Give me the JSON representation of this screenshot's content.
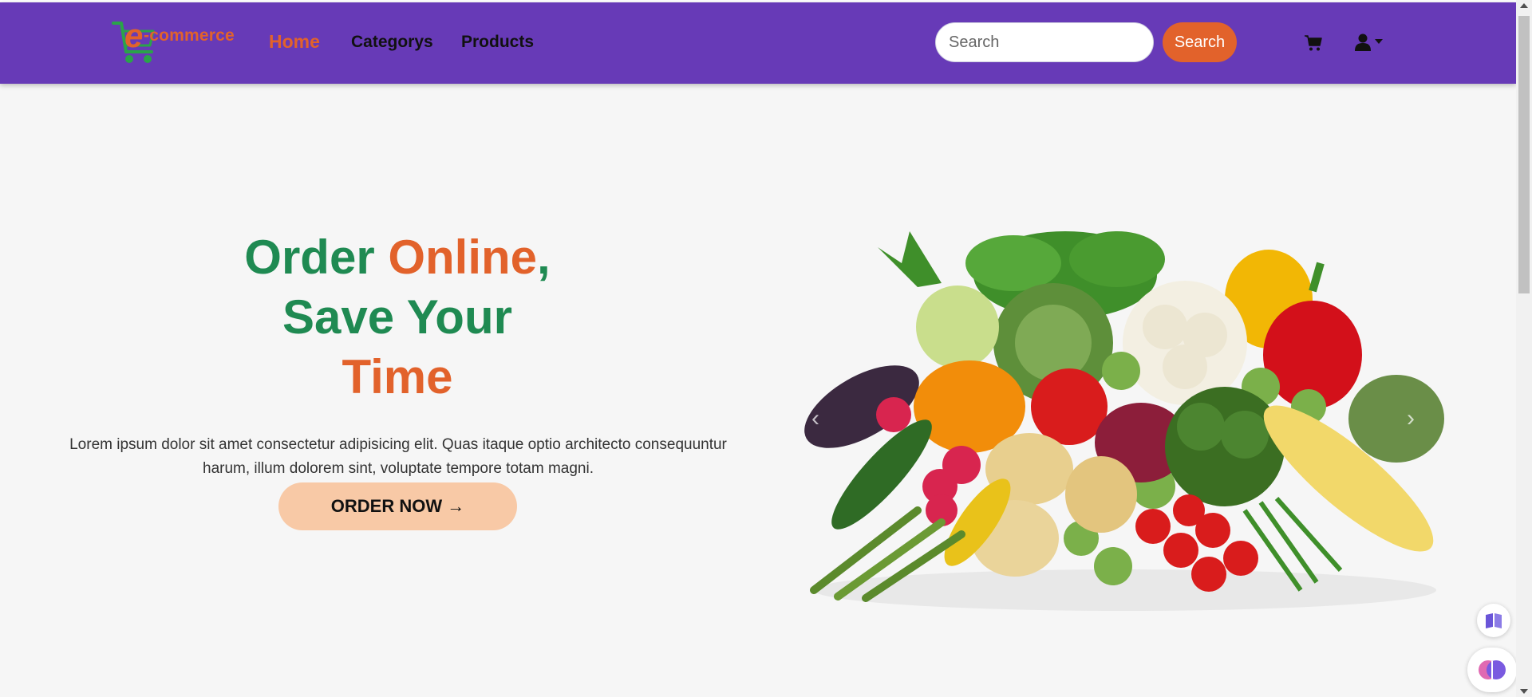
{
  "brand": {
    "logo_text": "-commerce",
    "logo_letter": "e"
  },
  "nav": {
    "home": "Home",
    "categorys": "Categorys",
    "products": "Products"
  },
  "search": {
    "placeholder": "Search",
    "button_label": "Search"
  },
  "icons": {
    "cart": "cart-icon",
    "user": "user-icon",
    "caret": "caret-down-icon",
    "reader": "book-icon",
    "assistant": "brain-icon"
  },
  "hero": {
    "line1_a": "Order ",
    "line1_b": "Online",
    "line1_c": ",",
    "line2": "Save Your",
    "line3": "Time",
    "description": "Lorem ipsum dolor sit amet consectetur adipisicing elit. Quas itaque optio architecto consequuntur harum, illum dolorem sint, voluptate tempore totam magni.",
    "cta_label": "ORDER NOW →"
  },
  "colors": {
    "navbar": "#673ab7",
    "accent": "#e2622b",
    "green": "#1f8a52",
    "cta_bg": "#f8c9a6",
    "page_bg": "#f6f6f6"
  }
}
